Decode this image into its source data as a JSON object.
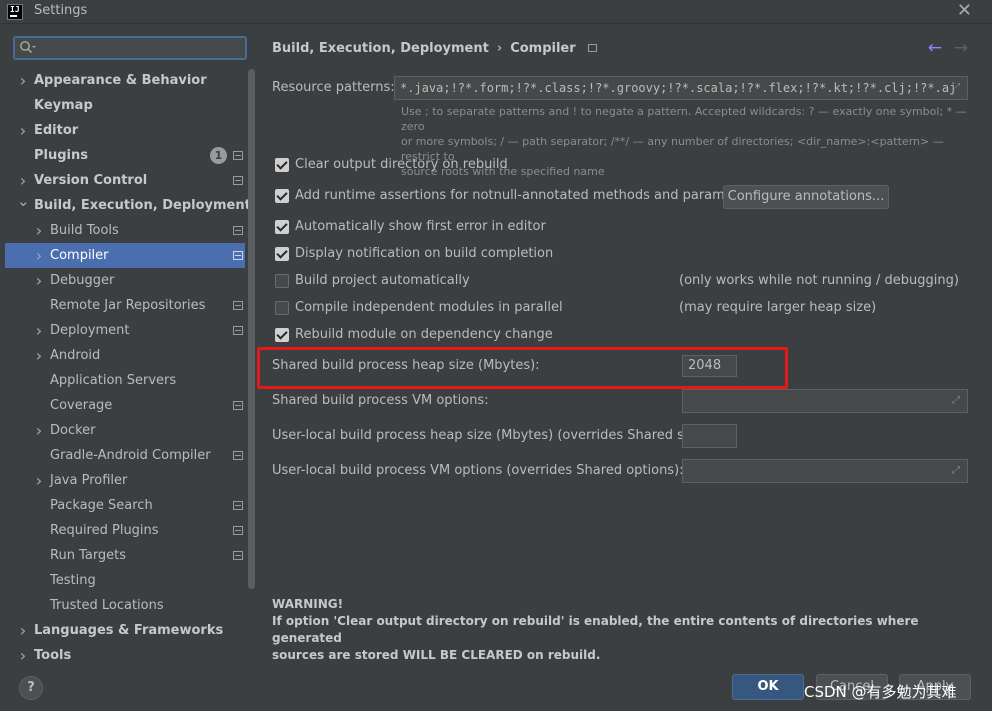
{
  "window": {
    "title": "Settings",
    "logo_text": "IJ"
  },
  "search": {
    "placeholder": ""
  },
  "sidebar": {
    "items": [
      {
        "label": "Appearance & Behavior",
        "level": 0,
        "chevron": "right"
      },
      {
        "label": "Keymap",
        "level": 0,
        "chevron": ""
      },
      {
        "label": "Editor",
        "level": 0,
        "chevron": "right"
      },
      {
        "label": "Plugins",
        "level": 0,
        "chevron": "",
        "badge": "1",
        "project_icon": true
      },
      {
        "label": "Version Control",
        "level": 0,
        "chevron": "right",
        "project_icon": true
      },
      {
        "label": "Build, Execution, Deployment",
        "level": 0,
        "chevron": "down"
      },
      {
        "label": "Build Tools",
        "level": 1,
        "chevron": "right",
        "project_icon": true
      },
      {
        "label": "Compiler",
        "level": 1,
        "chevron": "right",
        "project_icon": true,
        "selected": true
      },
      {
        "label": "Debugger",
        "level": 1,
        "chevron": "right"
      },
      {
        "label": "Remote Jar Repositories",
        "level": 1,
        "chevron": "",
        "project_icon": true
      },
      {
        "label": "Deployment",
        "level": 1,
        "chevron": "right",
        "project_icon": true
      },
      {
        "label": "Android",
        "level": 1,
        "chevron": "right"
      },
      {
        "label": "Application Servers",
        "level": 1,
        "chevron": ""
      },
      {
        "label": "Coverage",
        "level": 1,
        "chevron": "",
        "project_icon": true
      },
      {
        "label": "Docker",
        "level": 1,
        "chevron": "right"
      },
      {
        "label": "Gradle-Android Compiler",
        "level": 1,
        "chevron": "",
        "project_icon": true
      },
      {
        "label": "Java Profiler",
        "level": 1,
        "chevron": "right"
      },
      {
        "label": "Package Search",
        "level": 1,
        "chevron": "",
        "project_icon": true
      },
      {
        "label": "Required Plugins",
        "level": 1,
        "chevron": "",
        "project_icon": true
      },
      {
        "label": "Run Targets",
        "level": 1,
        "chevron": "",
        "project_icon": true
      },
      {
        "label": "Testing",
        "level": 1,
        "chevron": ""
      },
      {
        "label": "Trusted Locations",
        "level": 1,
        "chevron": ""
      },
      {
        "label": "Languages & Frameworks",
        "level": 0,
        "chevron": "right"
      },
      {
        "label": "Tools",
        "level": 0,
        "chevron": "right"
      }
    ]
  },
  "breadcrumb": {
    "parent": "Build, Execution, Deployment",
    "separator": "›",
    "current": "Compiler"
  },
  "resource": {
    "label": "Resource patterns:",
    "value": "*.java;!?*.form;!?*.class;!?*.groovy;!?*.scala;!?*.flex;!?*.kt;!?*.clj;!?*.aj",
    "hint_line1": "Use ; to separate patterns and ! to negate a pattern. Accepted wildcards: ? — exactly one symbol; * — zero",
    "hint_line2": "or more symbols; / — path separator; /**/ — any number of directories; <dir_name>:<pattern> — restrict to",
    "hint_line3": "source roots with the specified name"
  },
  "options": {
    "clear_output": "Clear output directory on rebuild",
    "runtime_assertions": "Add runtime assertions for notnull-annotated methods and parameters",
    "configure_button": "Configure annotations...",
    "show_first_error": "Automatically show first error in editor",
    "display_notification": "Display notification on build completion",
    "build_automatically": "Build project automatically",
    "build_automatically_note": "(only works while not running / debugging)",
    "compile_parallel": "Compile independent modules in parallel",
    "compile_parallel_note": "(may require larger heap size)",
    "rebuild_module": "Rebuild module on dependency change"
  },
  "heap": {
    "label": "Shared build process heap size (Mbytes):",
    "value": "2048"
  },
  "vm_options": {
    "label": "Shared build process VM options:",
    "value": ""
  },
  "user_heap": {
    "label": "User-local build process heap size (Mbytes) (overrides Shared size):",
    "value": ""
  },
  "user_vm": {
    "label": "User-local build process VM options (overrides Shared options):",
    "value": ""
  },
  "warning": {
    "title": "WARNING!",
    "line1": "If option 'Clear output directory on rebuild' is enabled, the entire contents of directories where generated",
    "line2": "sources are stored WILL BE CLEARED on rebuild."
  },
  "footer": {
    "help": "?",
    "ok": "OK",
    "cancel": "Cancel",
    "apply": "Apply",
    "watermark": "CSDN @有多勉为其难"
  },
  "colors": {
    "accent": "#4b6eaf",
    "ok_button": "#365880",
    "highlight": "#e11a1a",
    "nav_back": "#9b7bff"
  },
  "icons": [
    "app-logo-icon",
    "close-icon",
    "search-icon",
    "chevron-right-icon",
    "chevron-down-icon",
    "project-settings-icon",
    "expand-icon",
    "arrow-left-icon",
    "arrow-right-icon",
    "help-icon"
  ]
}
